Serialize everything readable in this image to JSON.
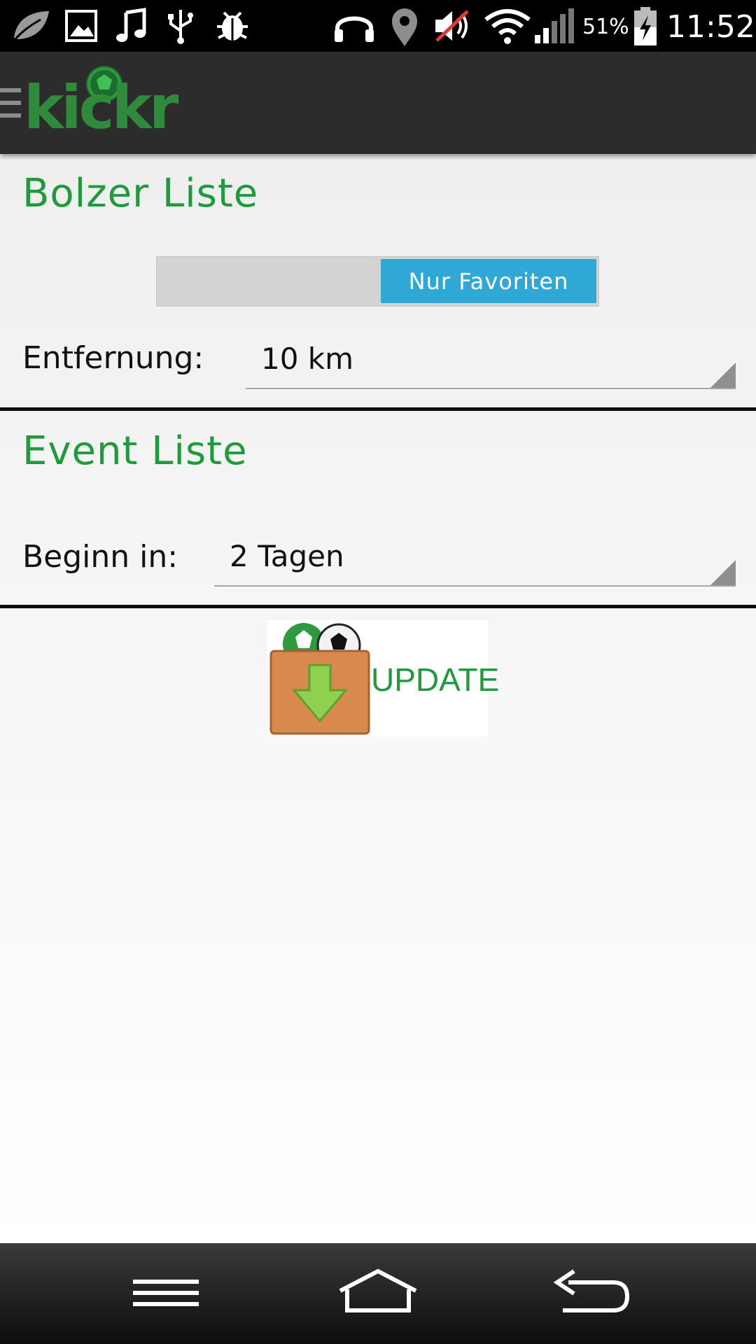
{
  "status_bar": {
    "battery_percent": "51%",
    "time": "11:52",
    "icons": [
      "leaf-icon",
      "gallery-icon",
      "music-icon",
      "usb-icon",
      "debug-bug-icon",
      "headset-icon",
      "location-icon",
      "mute-icon",
      "wifi-icon",
      "signal-icon",
      "battery-charging-icon"
    ]
  },
  "action_bar": {
    "logo_text": "kickr",
    "menu_icon": "drawer-menu-icon"
  },
  "bolzer": {
    "title": "Bolzer Liste",
    "toggle_label": "Nur Favoriten",
    "distance_label": "Entfernung:",
    "distance_value": "10 km"
  },
  "event": {
    "title": "Event Liste",
    "begin_label": "Beginn in:",
    "begin_value": "2 Tagen"
  },
  "update": {
    "label": "UPDATE",
    "icon": "download-box-icon"
  },
  "nav_bar": {
    "icons": [
      "menu-icon",
      "home-icon",
      "back-icon"
    ]
  },
  "colors": {
    "accent_green": "#1f9a3c",
    "toggle_blue": "#2fa8d6",
    "action_bar": "#2c2c2c"
  }
}
